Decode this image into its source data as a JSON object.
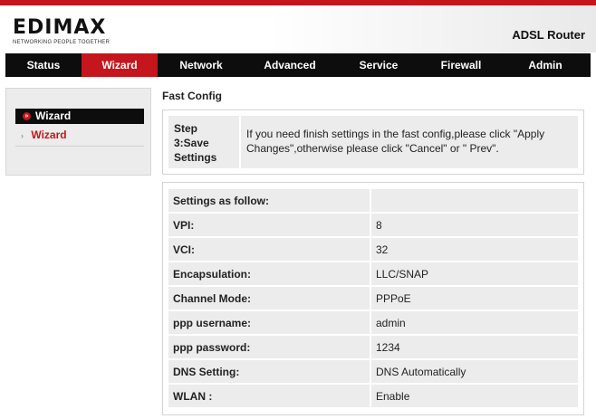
{
  "header": {
    "logo_text": "EDIMAX",
    "logo_tagline": "NETWORKING PEOPLE TOGETHER",
    "product": "ADSL Router",
    "accent_color": "#c4161c"
  },
  "nav": {
    "items": [
      {
        "label": "Status"
      },
      {
        "label": "Wizard",
        "active": true
      },
      {
        "label": "Network"
      },
      {
        "label": "Advanced"
      },
      {
        "label": "Service"
      },
      {
        "label": "Firewall"
      },
      {
        "label": "Admin"
      }
    ]
  },
  "sidebar": {
    "header": "Wizard",
    "header_icon": "bullet-arrow-icon",
    "items": [
      {
        "label": "Wizard",
        "icon": "chevron-right-icon"
      }
    ]
  },
  "main": {
    "title": "Fast Config",
    "step": {
      "label": "Step 3:Save Settings",
      "text": "If you need finish settings in the fast config,please click \"Apply Changes\",otherwise please click \"Cancel\" or \" Prev\"."
    },
    "settings": {
      "header": "Settings as follow:",
      "rows": [
        {
          "key": "VPI:",
          "value": "8"
        },
        {
          "key": "VCI:",
          "value": "32"
        },
        {
          "key": "Encapsulation:",
          "value": "LLC/SNAP"
        },
        {
          "key": "Channel Mode:",
          "value": "PPPoE"
        },
        {
          "key": "ppp username:",
          "value": "admin"
        },
        {
          "key": "ppp password:",
          "value": "1234"
        },
        {
          "key": "DNS Setting:",
          "value": "DNS Automatically"
        },
        {
          "key": "WLAN :",
          "value": "Enable"
        }
      ]
    }
  }
}
